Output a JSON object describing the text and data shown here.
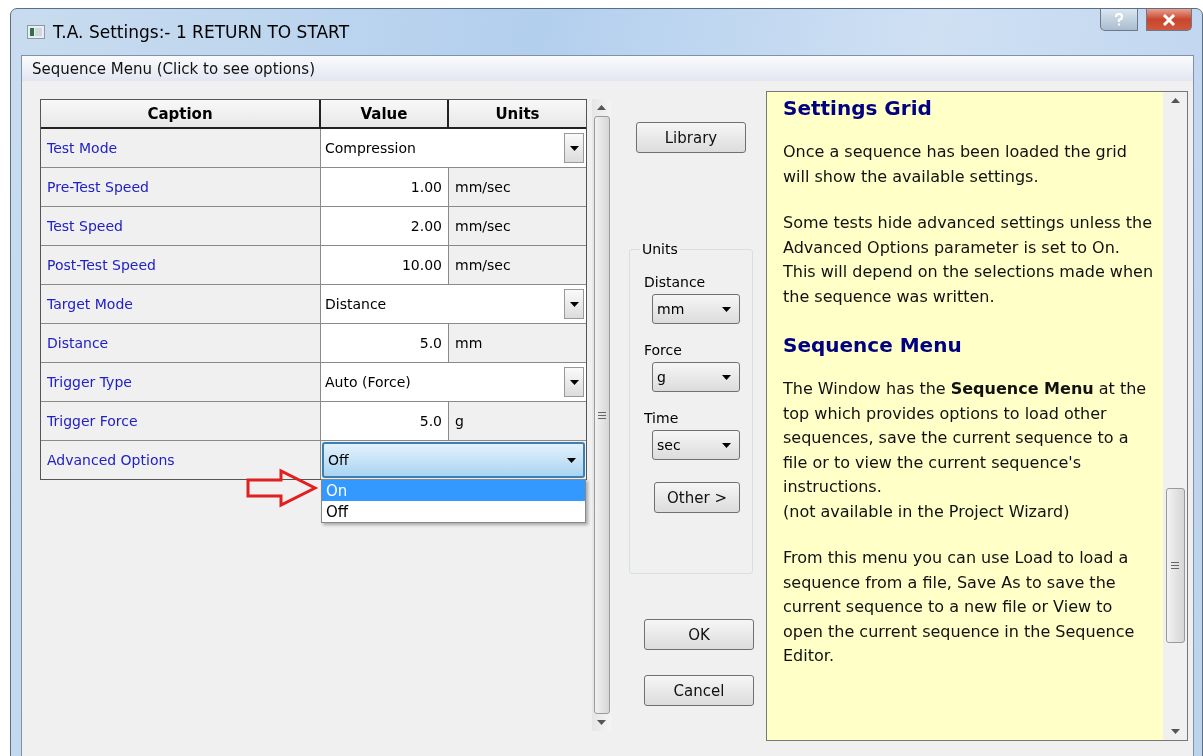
{
  "window": {
    "title": "T.A. Settings:- 1 RETURN TO START"
  },
  "menu": {
    "label": "Sequence Menu (Click to see options)"
  },
  "grid": {
    "columns": [
      "Caption",
      "Value",
      "Units"
    ],
    "rows": [
      {
        "caption": "Test Mode",
        "kind": "dropdown",
        "value": "Compression",
        "open": false
      },
      {
        "caption": "Pre-Test Speed",
        "kind": "number",
        "value": "1.00",
        "units": "mm/sec"
      },
      {
        "caption": "Test Speed",
        "kind": "number",
        "value": "2.00",
        "units": "mm/sec"
      },
      {
        "caption": "Post-Test Speed",
        "kind": "number",
        "value": "10.00",
        "units": "mm/sec"
      },
      {
        "caption": "Target Mode",
        "kind": "dropdown",
        "value": "Distance",
        "open": false
      },
      {
        "caption": "Distance",
        "kind": "number",
        "value": "5.0",
        "units": "mm"
      },
      {
        "caption": "Trigger Type",
        "kind": "dropdown",
        "value": "Auto (Force)",
        "open": false
      },
      {
        "caption": "Trigger Force",
        "kind": "number",
        "value": "5.0",
        "units": "g"
      },
      {
        "caption": "Advanced Options",
        "kind": "dropdown",
        "value": "Off",
        "open": true,
        "options": [
          {
            "label": "On",
            "highlighted": true
          },
          {
            "label": "Off",
            "highlighted": false
          }
        ]
      }
    ]
  },
  "library_button": "Library",
  "units": {
    "title": "Units",
    "fields": [
      {
        "label": "Distance",
        "value": "mm"
      },
      {
        "label": "Force",
        "value": "g"
      },
      {
        "label": "Time",
        "value": "sec"
      }
    ],
    "other_button": "Other  >"
  },
  "ok_button": "OK",
  "cancel_button": "Cancel",
  "help": [
    {
      "kind": "heading",
      "text": "Settings Grid"
    },
    {
      "kind": "para",
      "text": "Once a sequence has been loaded the grid will show the available settings."
    },
    {
      "kind": "para",
      "text": "Some tests hide advanced settings unless the Advanced Options parameter is set to On. This will depend on the selections made when the sequence was written."
    },
    {
      "kind": "heading",
      "text": "Sequence Menu"
    },
    {
      "kind": "para",
      "text": "The Window has the **Sequence Menu** at the top which provides options to load other sequences, save the current sequence to a file or to view the current sequence's instructions."
    },
    {
      "kind": "note",
      "text": "(not available in the Project Wizard)"
    },
    {
      "kind": "para",
      "text": "From this menu you can use Load to load a sequence from a file, Save As to save the current sequence to a new file or View to open the current sequence in the Sequence Editor."
    }
  ]
}
